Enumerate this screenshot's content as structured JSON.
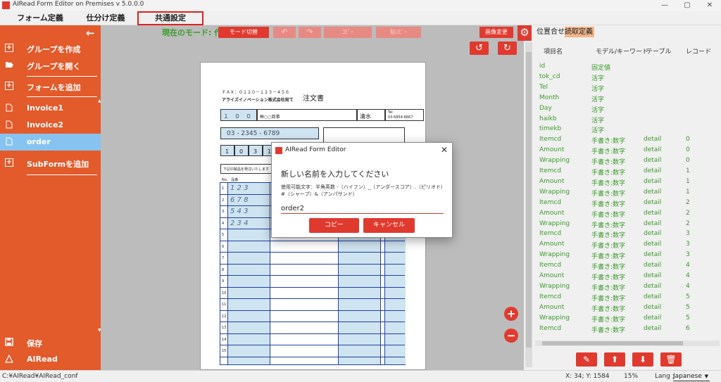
{
  "window": {
    "title": "AIRead Form Editor on Premises v 5.0.0.0",
    "controls": [
      "—",
      "▢",
      "✕"
    ]
  },
  "menu": {
    "tabs": [
      "フォーム定義",
      "仕分け定義",
      "共通設定"
    ]
  },
  "sidebar": {
    "back": "←",
    "items": [
      {
        "label": "グループを作成",
        "icon": "plus-square-icon"
      },
      {
        "label": "グループを開く",
        "icon": "folder-open-icon"
      },
      {
        "label": "フォームを追加",
        "icon": "plus-square-icon"
      },
      {
        "label": "Invoice1",
        "icon": "document-icon"
      },
      {
        "label": "Invoice2",
        "icon": "document-icon"
      },
      {
        "label": "order",
        "icon": "document-icon",
        "selected": true
      },
      {
        "label": "SubFormを追加",
        "icon": "plus-square-icon"
      }
    ],
    "save_label": "保存",
    "logo_text": "AIRead"
  },
  "toolbar": {
    "mode_label": "現在のモード: 作成",
    "mode_switch": "モード切替",
    "copy": "ｺﾋﾟｰ",
    "paste": "貼ｺﾋﾟｰ",
    "image_change": "画像変更",
    "undo": "↶",
    "redo": "↷",
    "rotate_left": "↺",
    "rotate_right": "↻"
  },
  "document": {
    "fax": "ＦＡＸ：０１２０－１２３－４５６",
    "company": "アライズイノベーション株式会社宛て",
    "title": "注文書",
    "code": "１　０　０",
    "client": "㈱○○商事",
    "person": "清水",
    "phone_label": "Tel",
    "phone": "03-6854-6667",
    "tel": "03 - 2345 - 6789",
    "date_digits": [
      "1",
      "0",
      "3",
      "1"
    ],
    "remarks": "下記の製品を発注いたします",
    "table_label": "No.　品番",
    "handwritten": [
      "1 2 3",
      "6 7 8",
      "5 4 3",
      "2 3 4"
    ],
    "row_numbers": [
      "1",
      "2",
      "3",
      "4",
      "5",
      "6",
      "7",
      "8",
      "9",
      "10",
      "11",
      "12",
      "13",
      "14",
      "15"
    ]
  },
  "zoom_buttons": {
    "in": "+",
    "out": "−"
  },
  "right_panel": {
    "tabs": [
      "位置合せ",
      "読取定義"
    ],
    "columns": [
      "項目名",
      "モデル/キーワード",
      "テーブル",
      "レコード"
    ],
    "rows": [
      {
        "name": "id",
        "model": "固定値",
        "table": "",
        "record": ""
      },
      {
        "name": "tok_cd",
        "model": "活字",
        "table": "",
        "record": ""
      },
      {
        "name": "Tel",
        "model": "活字",
        "table": "",
        "record": ""
      },
      {
        "name": "Month",
        "model": "活字",
        "table": "",
        "record": ""
      },
      {
        "name": "Day",
        "model": "活字",
        "table": "",
        "record": ""
      },
      {
        "name": "haikb",
        "model": "活字",
        "table": "",
        "record": ""
      },
      {
        "name": "timekb",
        "model": "活字",
        "table": "",
        "record": ""
      },
      {
        "name": "Itemcd",
        "model": "手書き:数字",
        "table": "detail",
        "record": "0"
      },
      {
        "name": "Amount",
        "model": "手書き:数字",
        "table": "detail",
        "record": "0"
      },
      {
        "name": "Wrapping",
        "model": "手書き:数字",
        "table": "detail",
        "record": "0"
      },
      {
        "name": "Itemcd",
        "model": "手書き:数字",
        "table": "detail",
        "record": "1"
      },
      {
        "name": "Amount",
        "model": "手書き:数字",
        "table": "detail",
        "record": "1"
      },
      {
        "name": "Wrapping",
        "model": "手書き:数字",
        "table": "detail",
        "record": "1"
      },
      {
        "name": "Itemcd",
        "model": "手書き:数字",
        "table": "detail",
        "record": "2"
      },
      {
        "name": "Amount",
        "model": "手書き:数字",
        "table": "detail",
        "record": "2"
      },
      {
        "name": "Wrapping",
        "model": "手書き:数字",
        "table": "detail",
        "record": "2"
      },
      {
        "name": "Itemcd",
        "model": "手書き:数字",
        "table": "detail",
        "record": "3"
      },
      {
        "name": "Amount",
        "model": "手書き:数字",
        "table": "detail",
        "record": "3"
      },
      {
        "name": "Wrapping",
        "model": "手書き:数字",
        "table": "detail",
        "record": "3"
      },
      {
        "name": "Itemcd",
        "model": "手書き:数字",
        "table": "detail",
        "record": "4"
      },
      {
        "name": "Amount",
        "model": "手書き:数字",
        "table": "detail",
        "record": "4"
      },
      {
        "name": "Wrapping",
        "model": "手書き:数字",
        "table": "detail",
        "record": "4"
      },
      {
        "name": "Itemcd",
        "model": "手書き:数字",
        "table": "detail",
        "record": "5"
      },
      {
        "name": "Amount",
        "model": "手書き:数字",
        "table": "detail",
        "record": "5"
      },
      {
        "name": "Wrapping",
        "model": "手書き:数字",
        "table": "detail",
        "record": "5"
      },
      {
        "name": "Itemcd",
        "model": "手書き:数字",
        "table": "detail",
        "record": "6"
      }
    ],
    "actions": [
      "pencil-icon",
      "arrow-up-icon",
      "arrow-down-icon",
      "trash-icon"
    ]
  },
  "dialog": {
    "title": "AIRead Form Editor",
    "prompt": "新しい名前を入力してください",
    "note": "使用可能文字：半角英数 -（ハイフン）_（アンダースコア）.（ピリオド）#（シャープ）&（アンパサンド）",
    "input_value": "order2",
    "copy_button": "コピー",
    "cancel_button": "キャンセル"
  },
  "status": {
    "path": "C:¥AIRead¥AIRead_conf",
    "coords": "X: 34; Y: 1584",
    "zoom": "15%",
    "lang_label": "Lang :",
    "lang_value": "Japanese"
  },
  "colors": {
    "accent": "#e03a2f",
    "sidebar": "#e35a2b",
    "selected": "#87c3f0",
    "mode_text": "#3a9a2a",
    "field_highlight": "#cfe4f1"
  }
}
